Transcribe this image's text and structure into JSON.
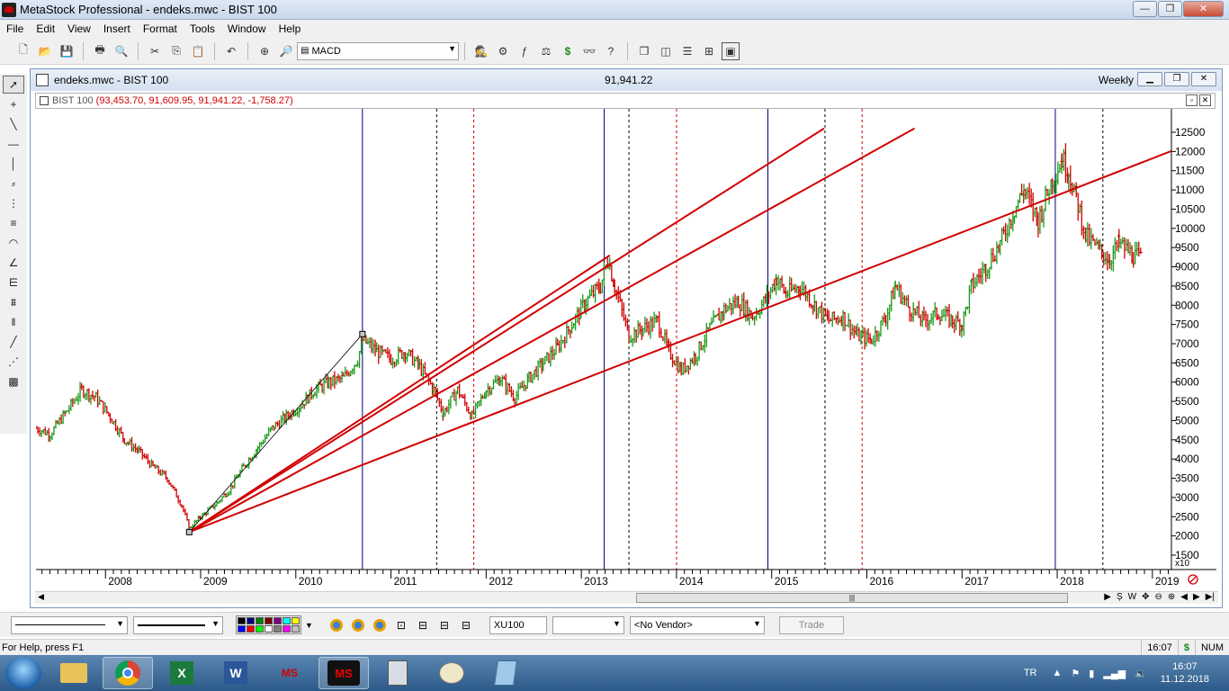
{
  "app": {
    "title": "MetaStock Professional - endeks.mwc - BIST 100",
    "win_minimize": "—",
    "win_restore": "❐",
    "win_close": "✕"
  },
  "menu": [
    "File",
    "Edit",
    "View",
    "Insert",
    "Format",
    "Tools",
    "Window",
    "Help"
  ],
  "toolbar": {
    "indicator_combo": "MACD",
    "combo_icon": "indicator-icon"
  },
  "document": {
    "title": "endeks.mwc - BIST 100",
    "last_price": "91,941.22",
    "period": "Weekly",
    "series_name": "BIST 100",
    "series_values": "(93,453.70, 91,609.95, 91,941.22, -1,758.27)",
    "y_axis_multiplier": "x10",
    "scroll_thumb_glyph": "|||"
  },
  "bottom": {
    "symbol": "XU100",
    "vendor": "<No Vendor>",
    "trade_label": "Trade",
    "colors": [
      "#000000",
      "#000080",
      "#008000",
      "#800000",
      "#800080",
      "#00ffff",
      "#ffff00",
      "#0000ff",
      "#ff0000",
      "#00ff00",
      "#ffffff",
      "#808080",
      "#ff00ff",
      "#c0c0c0"
    ]
  },
  "status": {
    "help_text": "For Help, press F1",
    "time": "16:07",
    "dollar": "$",
    "num": "NUM"
  },
  "taskbar": {
    "lang": "TR",
    "clock_time": "16:07",
    "clock_date": "11.12.2018",
    "apps": [
      "explorer",
      "chrome",
      "excel",
      "word",
      "metastock-downloader",
      "metastock",
      "calculator",
      "paint",
      "notepad"
    ]
  },
  "chart_data": {
    "type": "bar",
    "title": "BIST 100",
    "xlabel": "",
    "ylabel": "",
    "y_unit_multiplier": "x10",
    "ylim": [
      1500,
      12500
    ],
    "y_ticks": [
      1500,
      2000,
      2500,
      3000,
      3500,
      4000,
      4500,
      5000,
      5500,
      6000,
      6500,
      7000,
      7500,
      8000,
      8500,
      9000,
      9500,
      10000,
      10500,
      11000,
      11500,
      12000,
      12500
    ],
    "x_year_labels": [
      "2008",
      "2009",
      "2010",
      "2011",
      "2012",
      "2013",
      "2014",
      "2015",
      "2016",
      "2017",
      "2018",
      "2019"
    ],
    "x_range": [
      2007.27,
      2019.2
    ],
    "series": [
      {
        "name": "BIST 100",
        "points": [
          [
            2007.27,
            4800
          ],
          [
            2007.42,
            4650
          ],
          [
            2007.58,
            5200
          ],
          [
            2007.75,
            5800
          ],
          [
            2007.9,
            5600
          ],
          [
            2008.05,
            5100
          ],
          [
            2008.2,
            4500
          ],
          [
            2008.35,
            4200
          ],
          [
            2008.5,
            3800
          ],
          [
            2008.65,
            3500
          ],
          [
            2008.8,
            2800
          ],
          [
            2008.88,
            2200
          ],
          [
            2009.0,
            2500
          ],
          [
            2009.15,
            2800
          ],
          [
            2009.3,
            3200
          ],
          [
            2009.45,
            3800
          ],
          [
            2009.6,
            4300
          ],
          [
            2009.75,
            4800
          ],
          [
            2009.9,
            5100
          ],
          [
            2010.05,
            5400
          ],
          [
            2010.2,
            5800
          ],
          [
            2010.35,
            6000
          ],
          [
            2010.5,
            6100
          ],
          [
            2010.65,
            6600
          ],
          [
            2010.7,
            7100
          ],
          [
            2010.85,
            6800
          ],
          [
            2011.0,
            6600
          ],
          [
            2011.15,
            6800
          ],
          [
            2011.3,
            6400
          ],
          [
            2011.45,
            5800
          ],
          [
            2011.55,
            5200
          ],
          [
            2011.7,
            5800
          ],
          [
            2011.85,
            5100
          ],
          [
            2012.0,
            5800
          ],
          [
            2012.15,
            6100
          ],
          [
            2012.3,
            5600
          ],
          [
            2012.45,
            6100
          ],
          [
            2012.6,
            6500
          ],
          [
            2012.75,
            6900
          ],
          [
            2012.9,
            7500
          ],
          [
            2013.05,
            8100
          ],
          [
            2013.2,
            8500
          ],
          [
            2013.28,
            9200
          ],
          [
            2013.35,
            8500
          ],
          [
            2013.5,
            7200
          ],
          [
            2013.65,
            7400
          ],
          [
            2013.8,
            7600
          ],
          [
            2013.92,
            6800
          ],
          [
            2014.05,
            6300
          ],
          [
            2014.2,
            6700
          ],
          [
            2014.35,
            7400
          ],
          [
            2014.5,
            7900
          ],
          [
            2014.65,
            8100
          ],
          [
            2014.8,
            7700
          ],
          [
            2014.95,
            8200
          ],
          [
            2015.05,
            8700
          ],
          [
            2015.15,
            8300
          ],
          [
            2015.3,
            8500
          ],
          [
            2015.45,
            8000
          ],
          [
            2015.6,
            7600
          ],
          [
            2015.75,
            7700
          ],
          [
            2015.9,
            7200
          ],
          [
            2016.05,
            7100
          ],
          [
            2016.2,
            7700
          ],
          [
            2016.3,
            8500
          ],
          [
            2016.45,
            7900
          ],
          [
            2016.6,
            7600
          ],
          [
            2016.75,
            7800
          ],
          [
            2016.9,
            7600
          ],
          [
            2017.0,
            7500
          ],
          [
            2017.1,
            8500
          ],
          [
            2017.25,
            9000
          ],
          [
            2017.4,
            9600
          ],
          [
            2017.55,
            10500
          ],
          [
            2017.65,
            11000
          ],
          [
            2017.8,
            10200
          ],
          [
            2017.95,
            11300
          ],
          [
            2018.05,
            11800
          ],
          [
            2018.12,
            11500
          ],
          [
            2018.2,
            10800
          ],
          [
            2018.3,
            9800
          ],
          [
            2018.45,
            9400
          ],
          [
            2018.55,
            9200
          ],
          [
            2018.65,
            9600
          ],
          [
            2018.8,
            9300
          ],
          [
            2018.88,
            9194
          ]
        ]
      }
    ],
    "trendlines": [
      {
        "from": [
          2008.88,
          2100
        ],
        "to": [
          2013.3,
          9300
        ],
        "color": "#d10000"
      },
      {
        "from": [
          2008.88,
          2100
        ],
        "to": [
          2015.55,
          12600
        ],
        "color": "#d10000"
      },
      {
        "from": [
          2008.88,
          2100
        ],
        "to": [
          2016.5,
          12600
        ],
        "color": "#d10000"
      },
      {
        "from": [
          2008.88,
          2100
        ],
        "to": [
          2019.5,
          12300
        ],
        "color": "#d10000"
      },
      {
        "from": [
          2008.88,
          2100
        ],
        "to": [
          2010.7,
          7250
        ],
        "color": "#000000"
      }
    ],
    "vertical_lines": [
      {
        "x": 2010.7,
        "style": "solid",
        "color": "#000080"
      },
      {
        "x": 2011.48,
        "style": "dashed",
        "color": "#000000"
      },
      {
        "x": 2011.87,
        "style": "dashed",
        "color": "#d10000"
      },
      {
        "x": 2013.24,
        "style": "solid",
        "color": "#000080"
      },
      {
        "x": 2013.5,
        "style": "dashed",
        "color": "#000000"
      },
      {
        "x": 2014.0,
        "style": "dashed",
        "color": "#d10000"
      },
      {
        "x": 2014.96,
        "style": "solid",
        "color": "#000080"
      },
      {
        "x": 2015.56,
        "style": "dashed",
        "color": "#000000"
      },
      {
        "x": 2015.95,
        "style": "dashed",
        "color": "#d10000"
      },
      {
        "x": 2017.98,
        "style": "solid",
        "color": "#000080"
      },
      {
        "x": 2018.48,
        "style": "dashed",
        "color": "#000000"
      }
    ],
    "up_color": "#1a9a1a",
    "down_color": "#d10000",
    "grid": false
  }
}
